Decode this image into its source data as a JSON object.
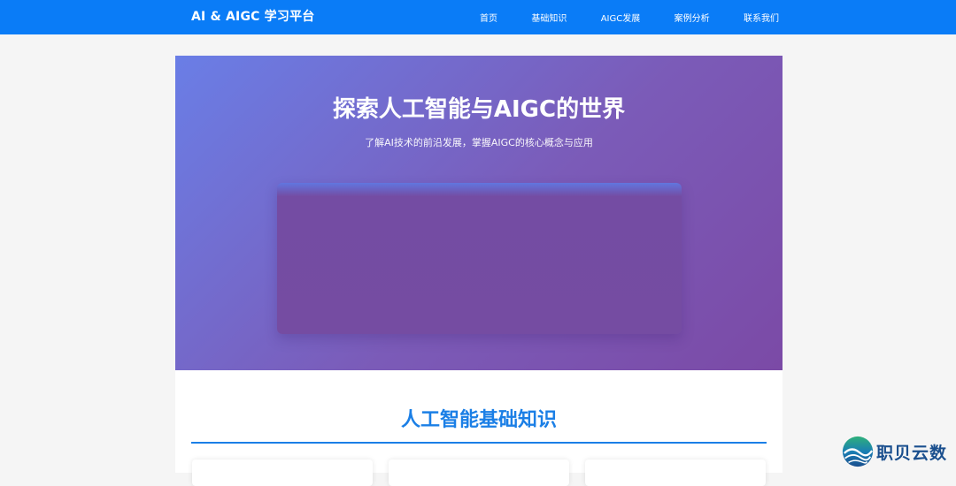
{
  "nav": {
    "brand": "AI & AIGC 学习平台",
    "links": [
      {
        "label": "首页"
      },
      {
        "label": "基础知识"
      },
      {
        "label": "AIGC发展"
      },
      {
        "label": "案例分析"
      },
      {
        "label": "联系我们"
      }
    ],
    "color": "#0a7cf7"
  },
  "hero": {
    "title": "探索人工智能与AIGC的世界",
    "subtitle": "了解AI技术的前沿发展，掌握AIGC的核心概念与应用"
  },
  "section": {
    "title": "人工智能基础知识",
    "color": "#1b7fe6"
  },
  "watermark": {
    "text": "职贝云数"
  }
}
